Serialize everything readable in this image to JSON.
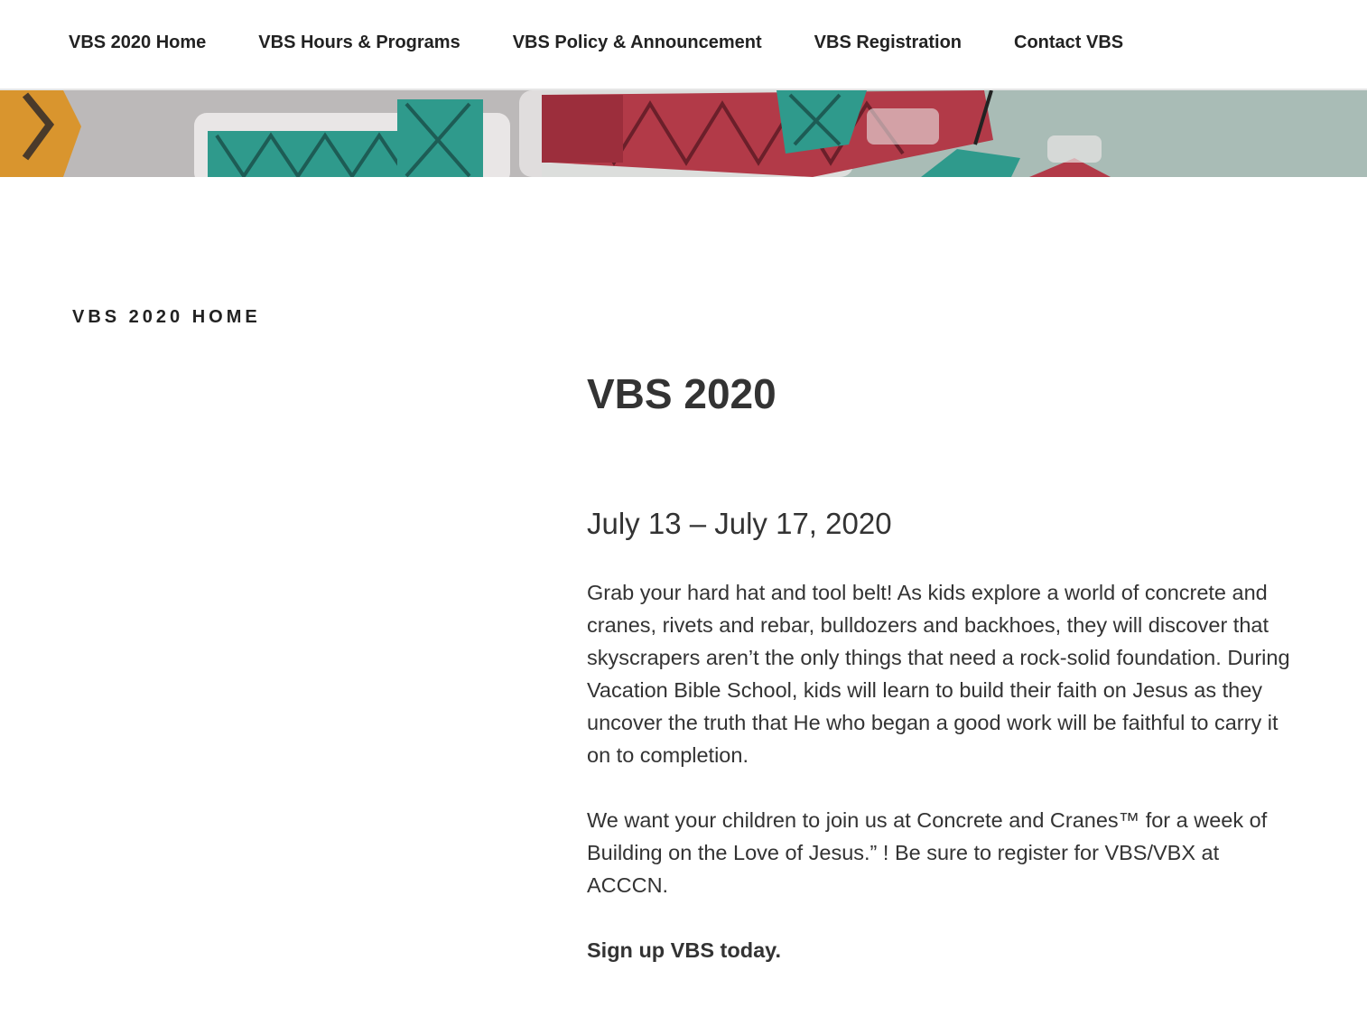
{
  "nav": {
    "items": [
      {
        "label": "VBS 2020 Home"
      },
      {
        "label": "VBS Hours & Programs"
      },
      {
        "label": "VBS Policy & Announcement"
      },
      {
        "label": "VBS Registration"
      },
      {
        "label": "Contact VBS"
      }
    ]
  },
  "banner": {
    "icon": "construction-cranes-image",
    "colors": {
      "teal": "#2f9a8c",
      "red": "#b23a48",
      "orange": "#e09a2a",
      "sky": "#a9bcb6"
    }
  },
  "page": {
    "section_label": "VBS 2020 HOME",
    "title": "VBS 2020",
    "date": "July 13 – July 17, 2020",
    "paragraph1": "Grab your hard hat and tool belt! As kids explore a world of concrete and cranes, rivets and rebar, bulldozers and backhoes, they will discover that skyscrapers aren’t the only things that need a rock-solid foundation. During Vacation Bible School, kids will learn to build their faith on Jesus as they uncover the truth that He who began a good work will be faithful to carry it on to completion.",
    "paragraph2": "We want your children to join us at Concrete and Cranes™ for a week of Building on the Love of Jesus.” !  Be sure to register for VBS/VBX at ACCCN.",
    "signup": "Sign up VBS today."
  }
}
